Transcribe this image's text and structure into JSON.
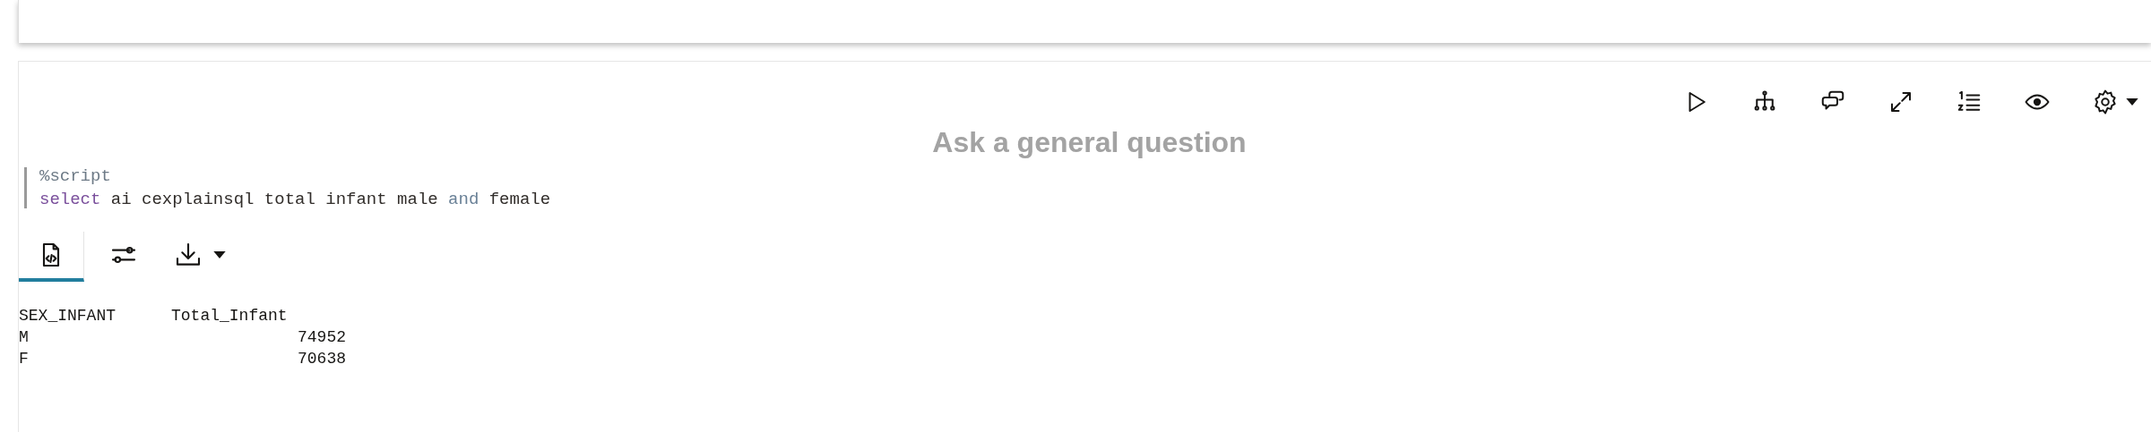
{
  "toolbar": [
    {
      "kind": "run"
    },
    {
      "kind": "tree"
    },
    {
      "kind": "chat"
    },
    {
      "kind": "expand"
    },
    {
      "kind": "list"
    },
    {
      "kind": "eye"
    },
    {
      "kind": "settings"
    }
  ],
  "heading": "Ask a general question",
  "code_lines": [
    [
      {
        "kind": "directive",
        "text": "%script"
      }
    ],
    [
      {
        "kind": "keyword",
        "text": "select"
      },
      {
        "kind": "plain",
        "text": " ai cexplainsql total infant male "
      },
      {
        "kind": "operator",
        "text": "and"
      },
      {
        "kind": "plain",
        "text": " female"
      }
    ]
  ],
  "result_tabs": [
    {
      "kind": "script",
      "selected": true
    },
    {
      "kind": "settings",
      "selected": false
    },
    {
      "kind": "download",
      "selected": false
    }
  ],
  "output": {
    "columns": [
      "SEX_INFANT",
      "Total_Infant"
    ],
    "rows": [
      [
        "M",
        "74952"
      ],
      [
        "F",
        "70638"
      ]
    ]
  }
}
